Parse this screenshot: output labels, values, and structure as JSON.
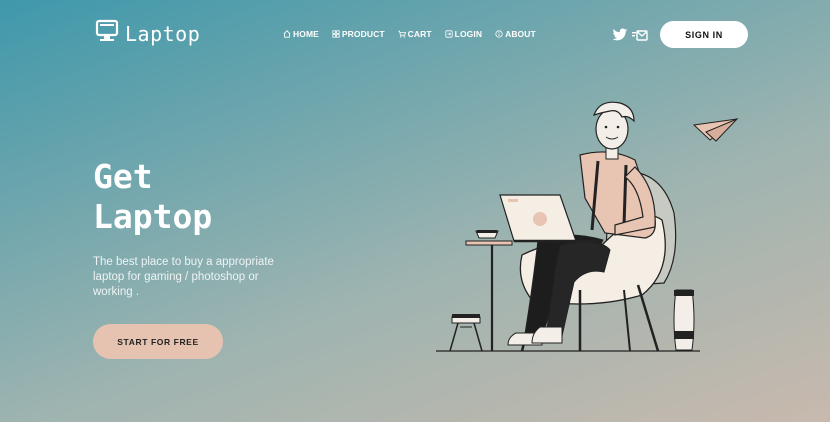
{
  "brand": {
    "name": "Laptop",
    "logo_icon": "monitor-icon"
  },
  "nav": {
    "items": [
      {
        "label": "HOME",
        "icon": "home-icon"
      },
      {
        "label": "PRODUCT",
        "icon": "grid-icon"
      },
      {
        "label": "CART",
        "icon": "cart-icon"
      },
      {
        "label": "LOGIN",
        "icon": "login-icon"
      },
      {
        "label": "ABOUT",
        "icon": "info-icon"
      }
    ]
  },
  "social": {
    "icons": [
      "twitter-icon",
      "mail-icon"
    ]
  },
  "header": {
    "signin_label": "SIGN IN"
  },
  "hero": {
    "title_line1": "Get",
    "title_line2": "Laptop",
    "subtitle": "The best place to buy a appropriate laptop for gaming / photoshop or working .",
    "cta_label": "START FOR FREE"
  },
  "colors": {
    "gradient_start": "#3f98ab",
    "gradient_end": "#c8b9ad",
    "accent": "#e6c3b1",
    "button_bg": "#ffffff"
  }
}
